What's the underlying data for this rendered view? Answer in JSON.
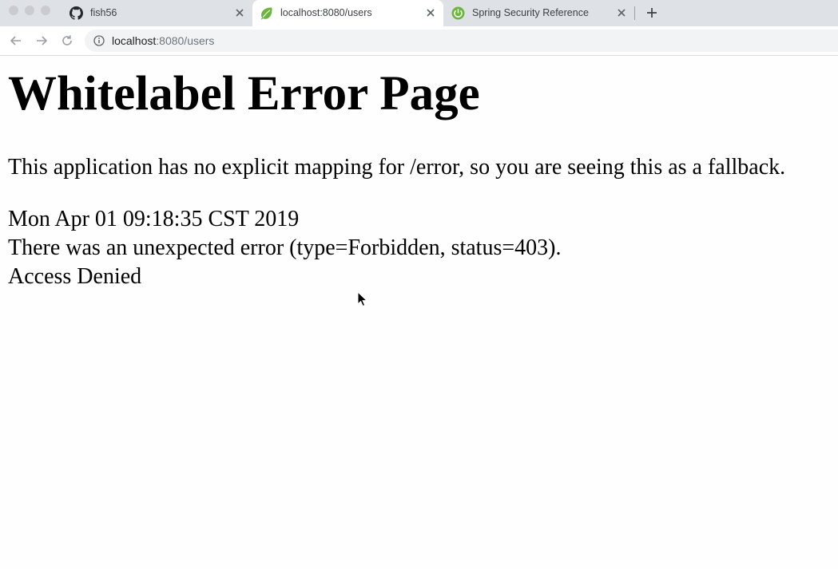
{
  "browser": {
    "tabs": [
      {
        "title": "fish56",
        "icon": "github-icon",
        "active": false
      },
      {
        "title": "localhost:8080/users",
        "icon": "spring-leaf-icon",
        "active": true
      },
      {
        "title": "Spring Security Reference",
        "icon": "spring-power-icon",
        "active": false
      }
    ],
    "new_tab_label": "+",
    "url": {
      "host": "localhost",
      "rest": ":8080/users"
    }
  },
  "page": {
    "heading": "Whitelabel Error Page",
    "message": "This application has no explicit mapping for /error, so you are seeing this as a fallback.",
    "timestamp": "Mon Apr 01 09:18:35 CST 2019",
    "error_line": "There was an unexpected error (type=Forbidden, status=403).",
    "error_detail": "Access Denied"
  },
  "colors": {
    "tabstrip": "#dee1e6",
    "active_tab": "#ffffff",
    "spring_green": "#6db33f"
  }
}
